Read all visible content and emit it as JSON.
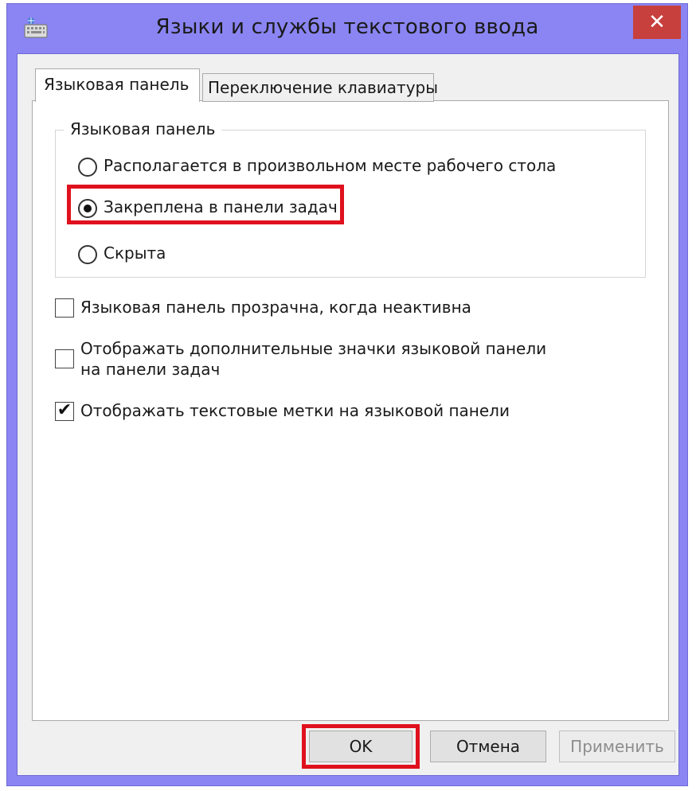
{
  "window": {
    "title": "Языки и службы текстового ввода",
    "close_symbol": "✕",
    "app_icon": "keyboard-icon"
  },
  "tabs": [
    {
      "label": "Языковая панель",
      "active": true
    },
    {
      "label": "Переключение клавиатуры",
      "active": false
    }
  ],
  "group": {
    "legend": "Языковая панель",
    "options": [
      {
        "label": "Располагается в произвольном месте рабочего стола",
        "checked": false
      },
      {
        "label": "Закреплена в панели задач",
        "checked": true
      },
      {
        "label": "Скрыта",
        "checked": false
      }
    ]
  },
  "checkboxes": [
    {
      "label": "Языковая панель прозрачна, когда неактивна",
      "checked": false
    },
    {
      "label": "Отображать дополнительные значки языковой панели на панели задач",
      "checked": false
    },
    {
      "label": "Отображать текстовые метки на языковой панели",
      "checked": true
    }
  ],
  "buttons": {
    "ok": "OK",
    "cancel": "Отмена",
    "apply": "Применить",
    "apply_disabled": true
  },
  "colors": {
    "window_frame": "#8a85f2",
    "close_button": "#c7403d",
    "highlight": "#e0111e",
    "dialog_bg": "#f0f0f0"
  }
}
